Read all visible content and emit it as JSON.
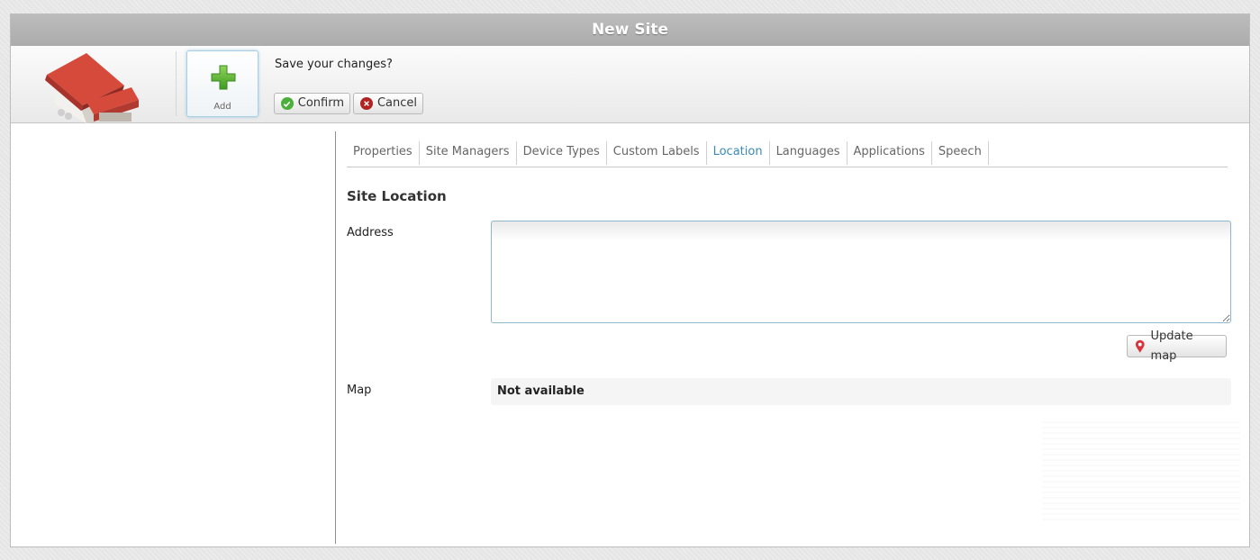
{
  "window": {
    "title": "New Site"
  },
  "toolbar": {
    "add_label": "Add",
    "prompt": "Save your changes?",
    "confirm_label": "Confirm",
    "cancel_label": "Cancel"
  },
  "tabs": [
    {
      "label": "Properties"
    },
    {
      "label": "Site Managers"
    },
    {
      "label": "Device Types"
    },
    {
      "label": "Custom Labels"
    },
    {
      "label": "Location",
      "active": true
    },
    {
      "label": "Languages"
    },
    {
      "label": "Applications"
    },
    {
      "label": "Speech"
    }
  ],
  "location": {
    "section_title": "Site Location",
    "address_label": "Address",
    "address_value": "",
    "update_map_label": "Update map",
    "map_label": "Map",
    "map_value": "Not available"
  },
  "colors": {
    "active_tab": "#3b8ab8",
    "confirm_icon": "#4caf3c",
    "cancel_icon": "#b22222",
    "titlebar": "#b4b4b4"
  },
  "icons": [
    "building-logo-icon",
    "plus-icon",
    "check-icon",
    "close-icon",
    "map-pin-icon"
  ]
}
